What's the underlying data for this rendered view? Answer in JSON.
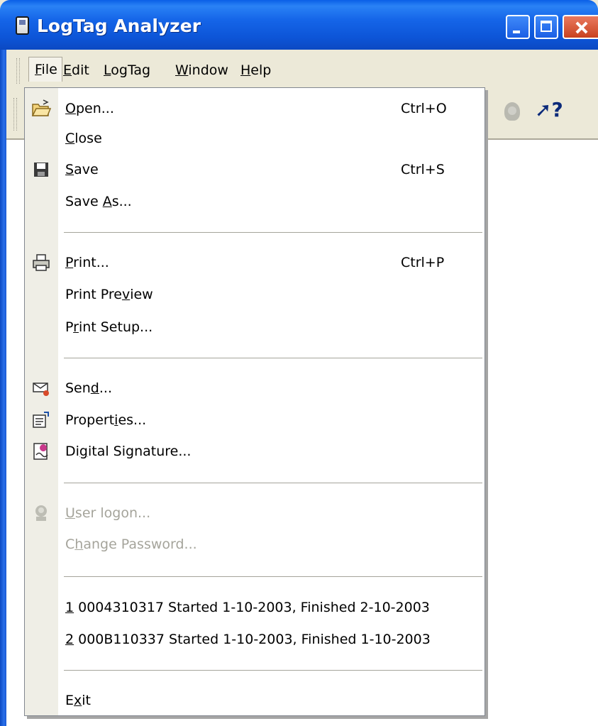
{
  "window": {
    "title": "LogTag Analyzer"
  },
  "menubar": {
    "items": [
      {
        "label": "File",
        "mnemonic": "F",
        "rest": "ile"
      },
      {
        "label": "Edit",
        "mnemonic": "E",
        "rest": "dit"
      },
      {
        "label": "LogTag",
        "mnemonic": "L",
        "rest": "ogTag"
      },
      {
        "label": "Window",
        "mnemonic": "W",
        "rest": "indow"
      },
      {
        "label": "Help",
        "mnemonic": "H",
        "rest": "elp"
      }
    ]
  },
  "toolbar": {
    "icons": [
      "user-logon-icon",
      "whats-this-help-icon"
    ],
    "whatsthis_glyph": "?"
  },
  "file_menu": {
    "items": [
      {
        "pre": "",
        "mn": "O",
        "post": "pen...",
        "shortcut": "Ctrl+O",
        "icon": "open-folder-icon",
        "enabled": true
      },
      {
        "pre": "",
        "mn": "C",
        "post": "lose",
        "shortcut": "",
        "icon": "",
        "enabled": true
      },
      {
        "pre": "",
        "mn": "S",
        "post": "ave",
        "shortcut": "Ctrl+S",
        "icon": "floppy-disk-icon",
        "enabled": true
      },
      {
        "pre": "Save ",
        "mn": "A",
        "post": "s...",
        "shortcut": "",
        "icon": "",
        "enabled": true
      },
      {
        "pre": "",
        "mn": "P",
        "post": "rint...",
        "shortcut": "Ctrl+P",
        "icon": "printer-icon",
        "enabled": true
      },
      {
        "pre": "Print Pre",
        "mn": "v",
        "post": "iew",
        "shortcut": "",
        "icon": "",
        "enabled": true
      },
      {
        "pre": "P",
        "mn": "r",
        "post": "int Setup...",
        "shortcut": "",
        "icon": "",
        "enabled": true
      },
      {
        "pre": "Sen",
        "mn": "d",
        "post": "...",
        "shortcut": "",
        "icon": "send-mail-icon",
        "enabled": true
      },
      {
        "pre": "Propert",
        "mn": "i",
        "post": "es...",
        "shortcut": "",
        "icon": "properties-icon",
        "enabled": true
      },
      {
        "pre": "Di",
        "mn": "g",
        "post": "ital Signature...",
        "shortcut": "",
        "icon": "digital-signature-icon",
        "enabled": true
      },
      {
        "pre": "",
        "mn": "U",
        "post": "ser logon...",
        "shortcut": "",
        "icon": "user-logon-icon",
        "enabled": false
      },
      {
        "pre": "C",
        "mn": "h",
        "post": "ange Password...",
        "shortcut": "",
        "icon": "",
        "enabled": false
      },
      {
        "pre": "",
        "mn": "1",
        "post": " 0004310317 Started 1-10-2003, Finished 2-10-2003",
        "shortcut": "",
        "icon": "",
        "enabled": true
      },
      {
        "pre": "",
        "mn": "2",
        "post": " 000B110337 Started 1-10-2003, Finished 1-10-2003",
        "shortcut": "",
        "icon": "",
        "enabled": true
      },
      {
        "pre": "E",
        "mn": "x",
        "post": "it",
        "shortcut": "",
        "icon": "",
        "enabled": true
      }
    ]
  },
  "colors": {
    "titlebar_blue": "#0d55d8",
    "menu_bg": "#ffffff",
    "gutter_bg": "#efeee6",
    "disabled_text": "#a5a49b",
    "chrome": "#ece9d8"
  }
}
